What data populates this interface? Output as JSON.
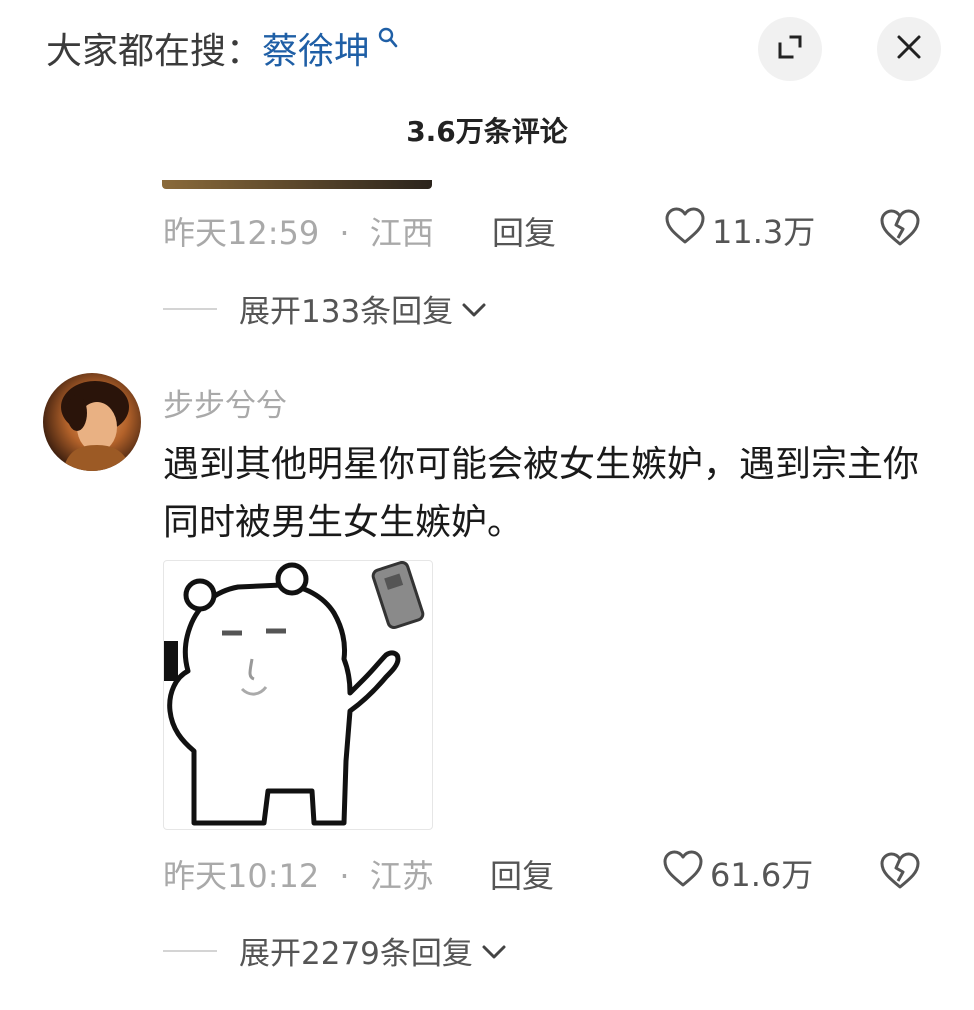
{
  "header": {
    "search_prefix": "大家都在搜：",
    "search_term": "蔡徐坤",
    "search_icon": "search-icon",
    "expand_icon": "expand-icon",
    "close_icon": "close-icon"
  },
  "comment_count": "3.6万条评论",
  "comments": [
    {
      "time": "昨天12:59",
      "location": "江西",
      "reply_label": "回复",
      "likes": "11.3万",
      "expand_replies": "展开133条回复"
    },
    {
      "username": "步步兮兮",
      "text": "遇到其他明星你可能会被女生嫉妒，遇到宗主你同时被男生女生嫉妒。",
      "time": "昨天10:12",
      "location": "江苏",
      "reply_label": "回复",
      "likes": "61.6万",
      "expand_replies": "展开2279条回复"
    }
  ],
  "meta_separator": "·",
  "colors": {
    "link": "#1f5fa6",
    "muted": "#a9a9a9",
    "text": "#1a1a1a"
  }
}
